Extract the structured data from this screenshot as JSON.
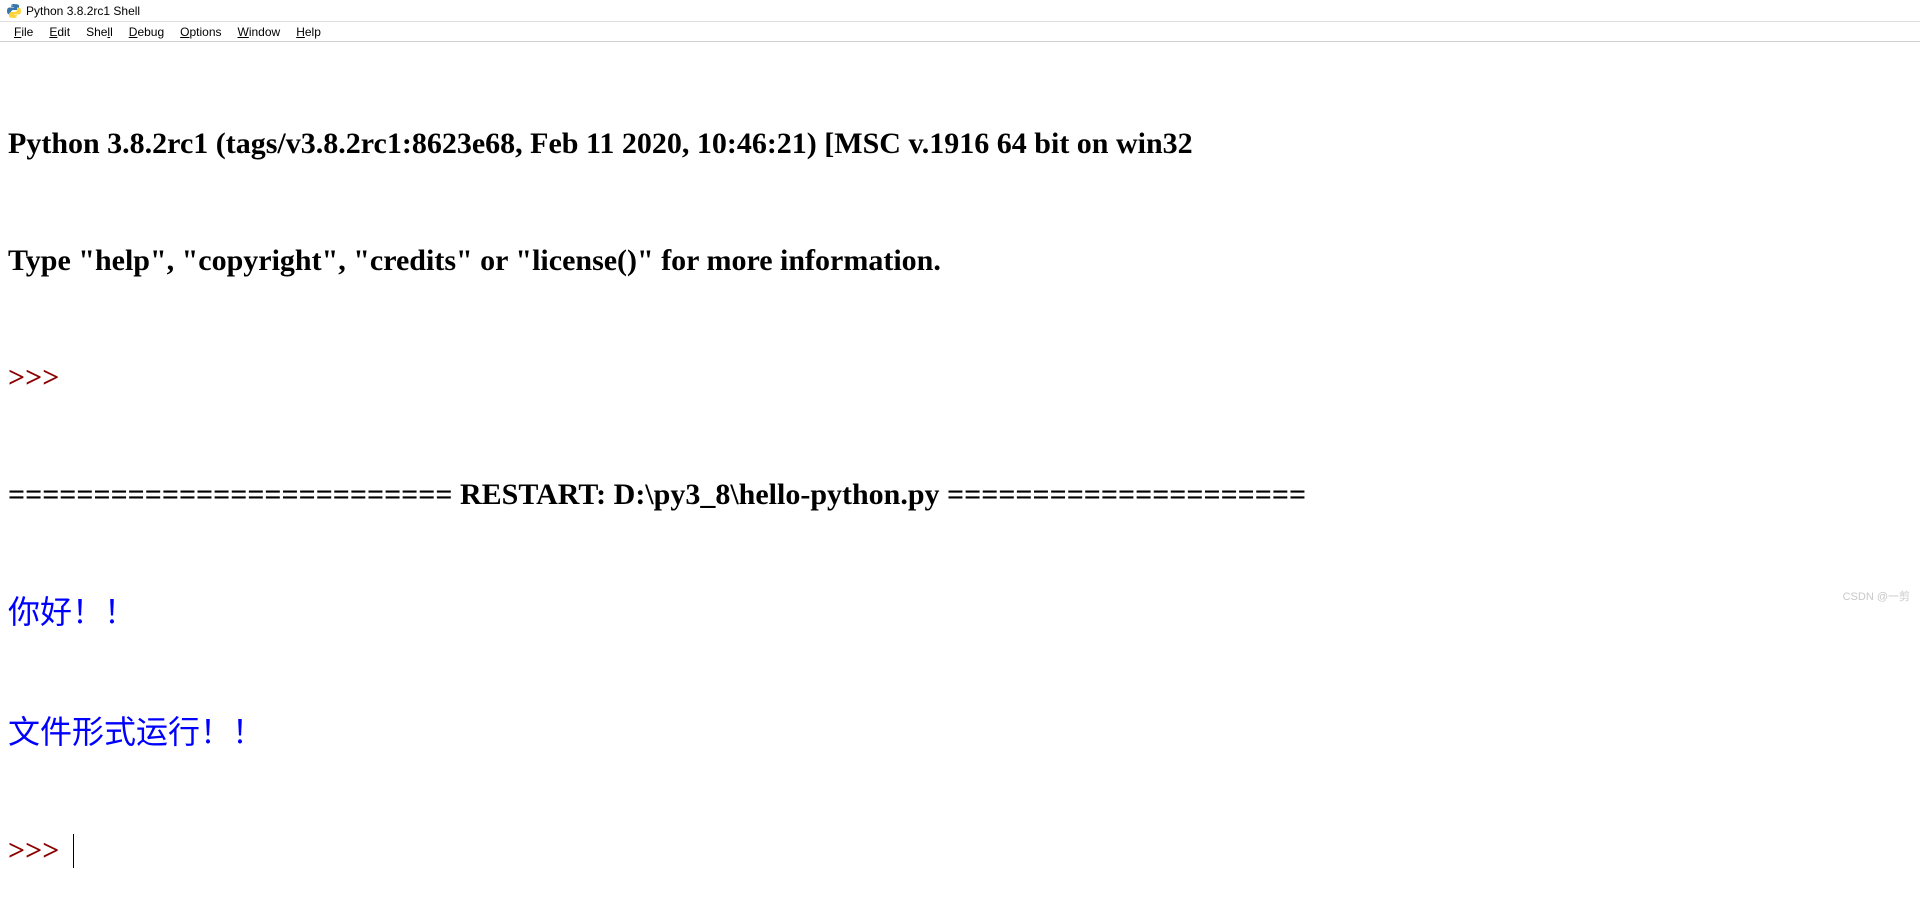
{
  "window": {
    "title": "Python 3.8.2rc1 Shell"
  },
  "menu": {
    "items": [
      {
        "label": "File",
        "key": "F"
      },
      {
        "label": "Edit",
        "key": "E"
      },
      {
        "label": "Shell",
        "key": "S"
      },
      {
        "label": "Debug",
        "key": "D"
      },
      {
        "label": "Options",
        "key": "O"
      },
      {
        "label": "Window",
        "key": "W"
      },
      {
        "label": "Help",
        "key": "H"
      }
    ]
  },
  "shell": {
    "banner1": "Python 3.8.2rc1 (tags/v3.8.2rc1:8623e68, Feb 11 2020, 10:46:21) [MSC v.1916 64 bit on win32",
    "banner2": "Type \"help\", \"copyright\", \"credits\" or \"license()\" for more information.",
    "prompt1": ">>> ",
    "restart_line": "========================== RESTART: D:\\py3_8\\hello-python.py =====================",
    "output1": "你好！！",
    "output2": "文件形式运行！！",
    "prompt2": ">>> "
  },
  "watermark": "CSDN @一剪"
}
